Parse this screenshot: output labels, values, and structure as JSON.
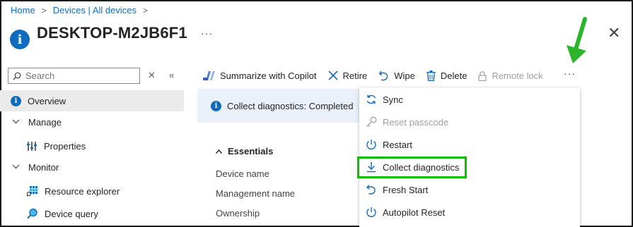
{
  "breadcrumb": {
    "home": "Home",
    "devices": "Devices | All devices",
    "separator": ">"
  },
  "page": {
    "title": "DESKTOP-M2JB6F1",
    "more": "···",
    "close": "✕"
  },
  "sidebar": {
    "search_placeholder": "Search",
    "items": [
      {
        "label": "Overview",
        "icon": "info-icon",
        "selected": true
      },
      {
        "label": "Manage",
        "icon": "chevron-down-icon"
      },
      {
        "label": "Properties",
        "icon": "properties-icon"
      },
      {
        "label": "Monitor",
        "icon": "chevron-down-icon"
      },
      {
        "label": "Resource explorer",
        "icon": "resource-explorer-icon"
      },
      {
        "label": "Device query",
        "icon": "device-query-icon"
      }
    ]
  },
  "toolbar": {
    "summarize": "Summarize with Copilot",
    "retire": "Retire",
    "wipe": "Wipe",
    "delete": "Delete",
    "remote_lock": "Remote lock",
    "more": "···"
  },
  "info_bar": {
    "text": "Collect diagnostics: Completed"
  },
  "essentials": {
    "heading": "Essentials",
    "rows": [
      "Device name",
      "Management name",
      "Ownership"
    ]
  },
  "menu": {
    "items": [
      {
        "label": "Sync",
        "icon": "sync-icon",
        "disabled": false
      },
      {
        "label": "Reset passcode",
        "icon": "key-icon",
        "disabled": true
      },
      {
        "label": "Restart",
        "icon": "power-icon",
        "disabled": false
      },
      {
        "label": "Collect diagnostics",
        "icon": "download-icon",
        "disabled": false,
        "highlighted": true
      },
      {
        "label": "Fresh Start",
        "icon": "undo-icon",
        "disabled": false
      },
      {
        "label": "Autopilot Reset",
        "icon": "power-icon",
        "disabled": false
      }
    ]
  },
  "colors": {
    "accent": "#0f6cbd",
    "highlight": "#0abf00",
    "arrow": "#2bb52b",
    "info_bg": "#eaf1fb"
  }
}
